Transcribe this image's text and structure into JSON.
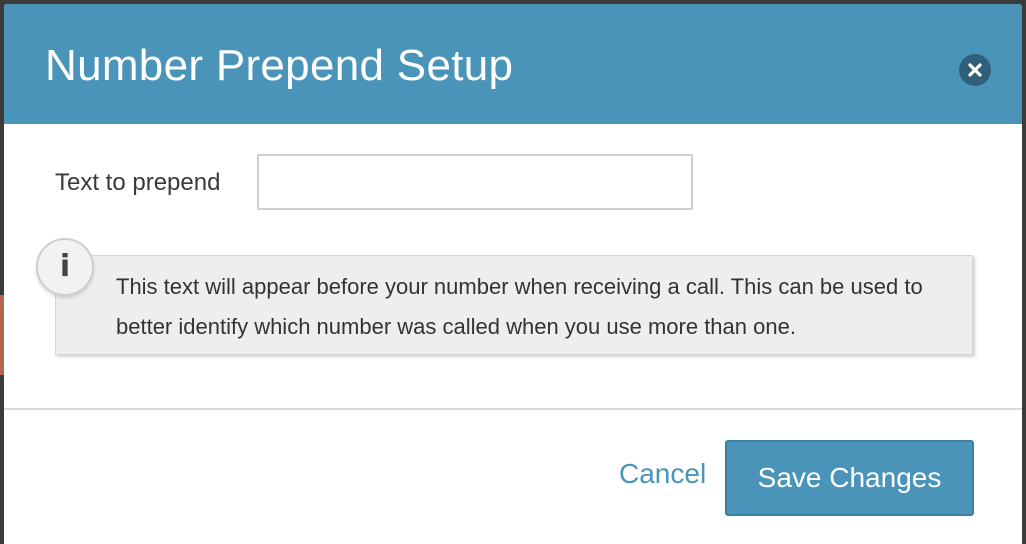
{
  "dialog": {
    "title": "Number Prepend Setup",
    "close_icon": "close-icon"
  },
  "form": {
    "label": "Text to prepend",
    "input_value": "",
    "input_placeholder": ""
  },
  "info": {
    "icon": "info-icon",
    "icon_glyph": "i",
    "text": "This text will appear before your number when receiving a call. This can be used to better identify which number was called when you use more than one."
  },
  "footer": {
    "cancel_label": "Cancel",
    "save_label": "Save Changes"
  },
  "colors": {
    "header": "#4a93b9",
    "accent": "#4a93b9",
    "close_button": "#2f5f79"
  }
}
